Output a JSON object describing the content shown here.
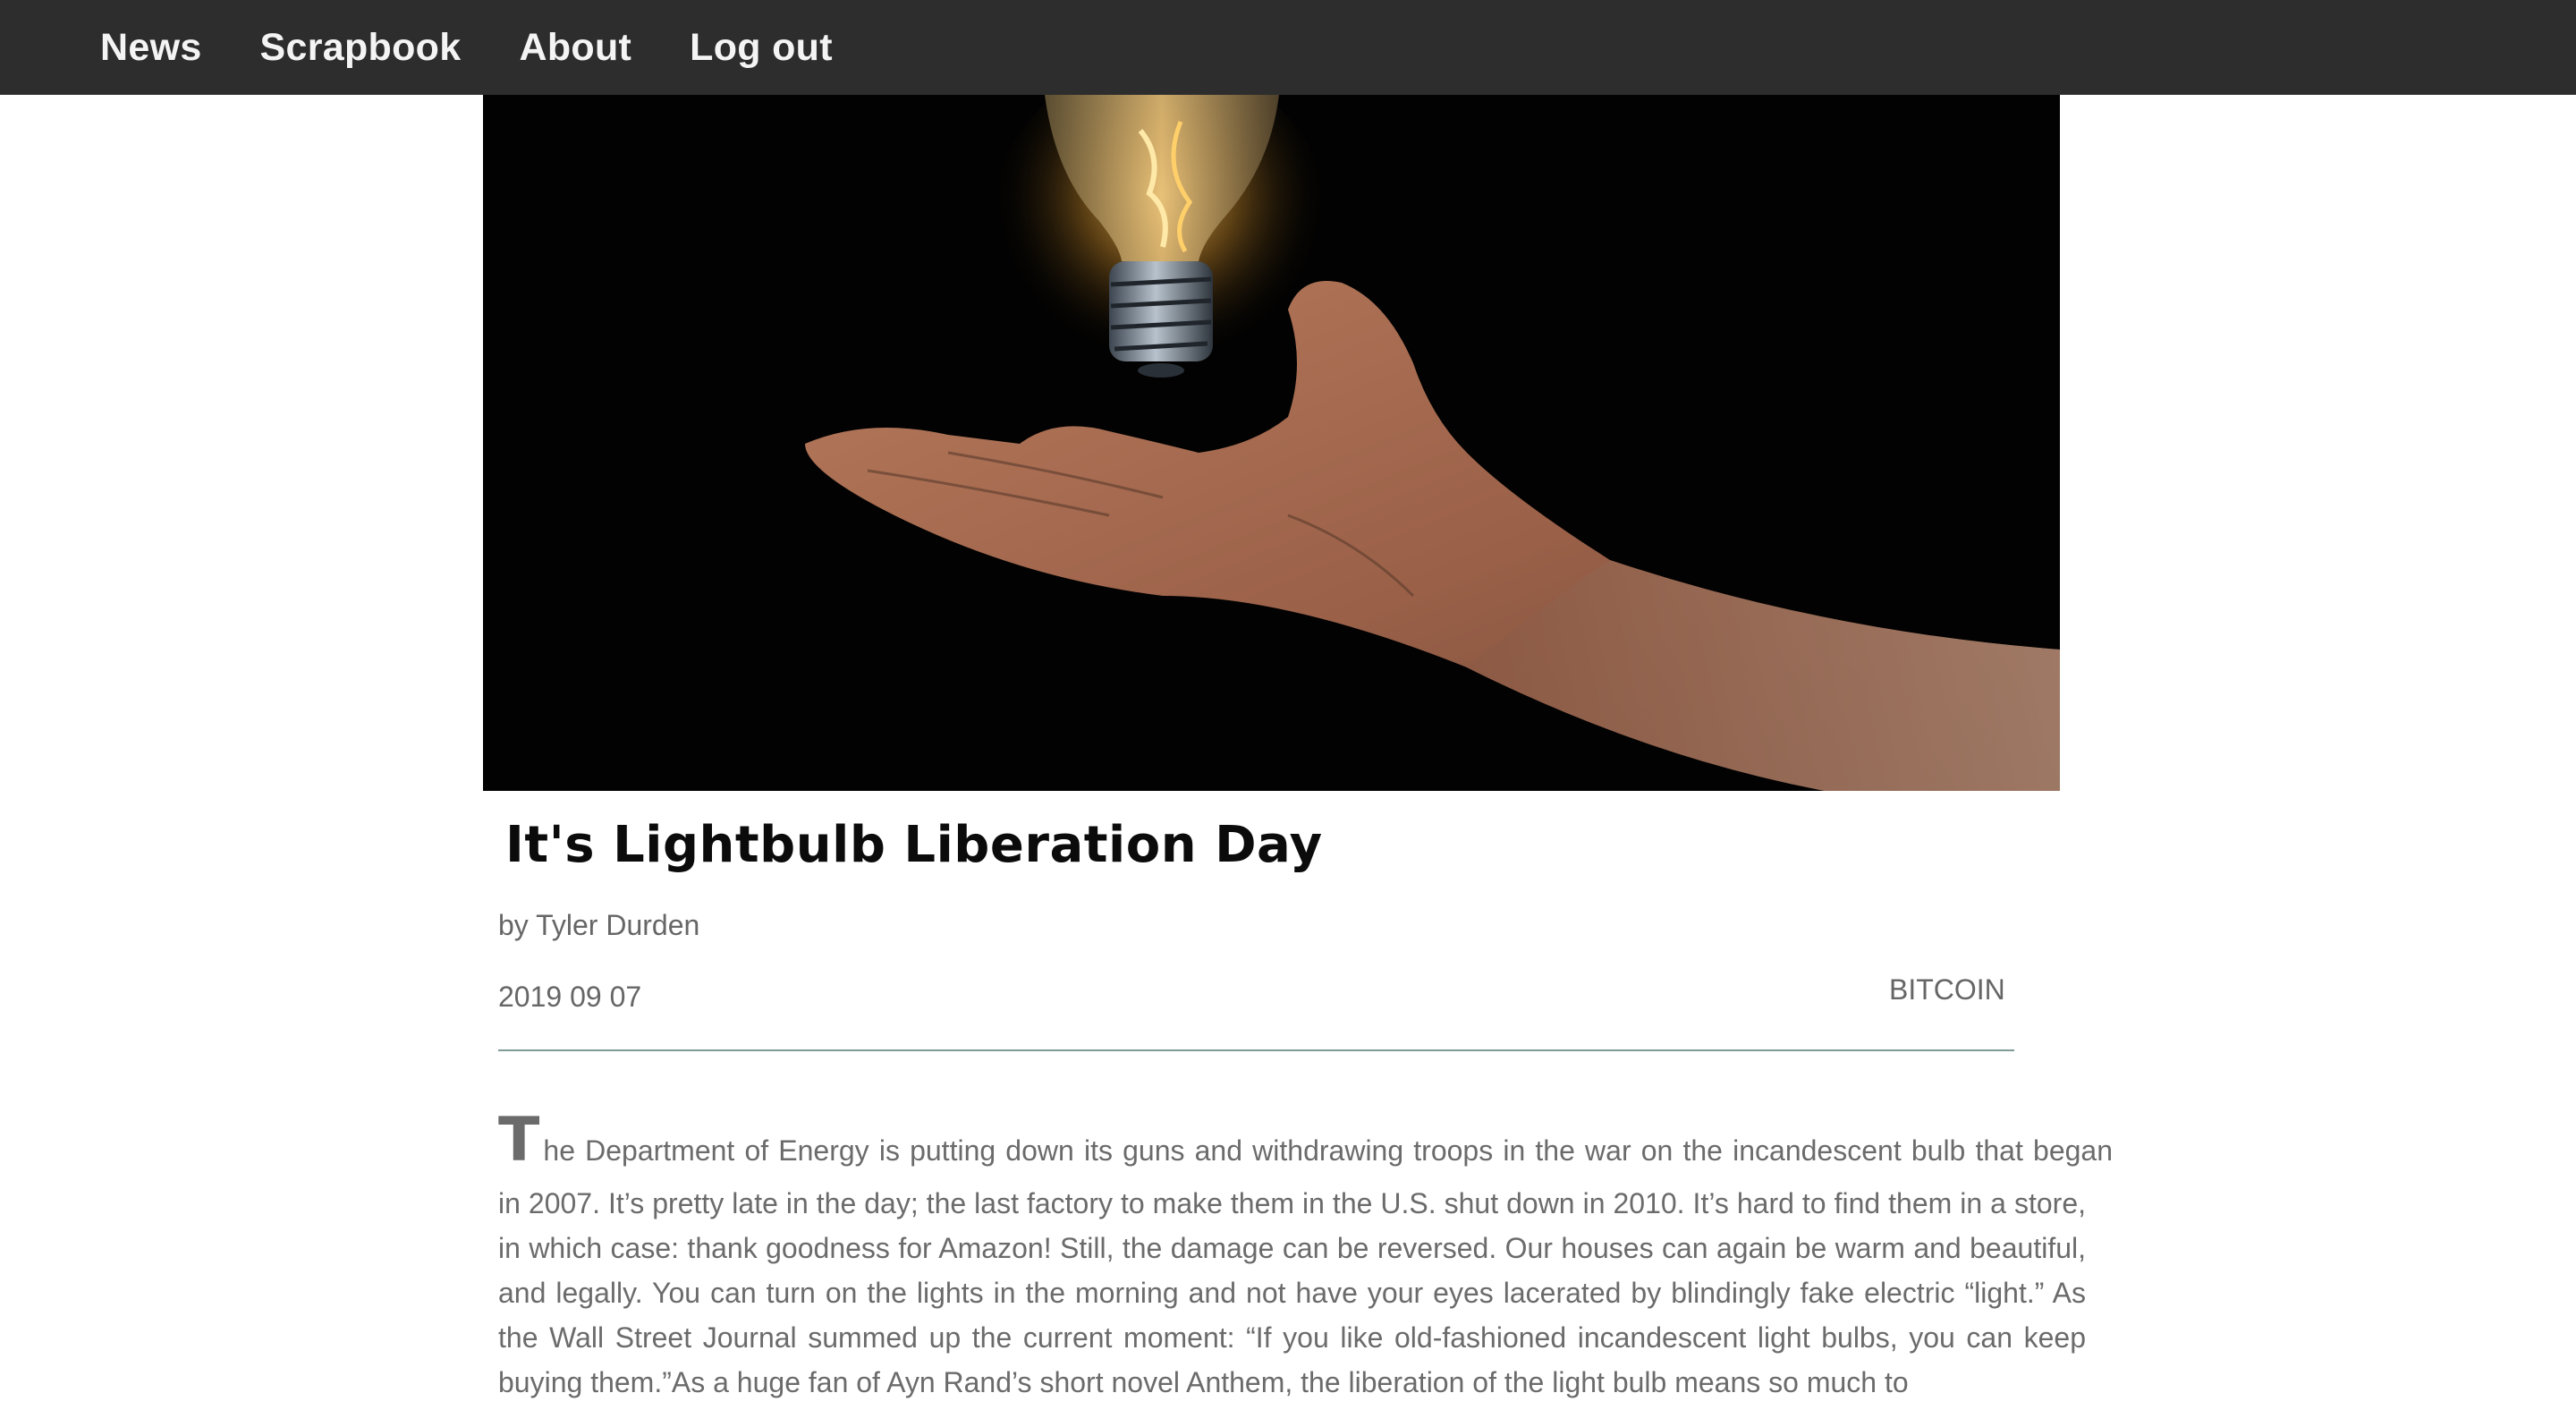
{
  "nav": {
    "items": [
      {
        "label": "News"
      },
      {
        "label": "Scrapbook"
      },
      {
        "label": "About"
      },
      {
        "label": "Log out"
      }
    ]
  },
  "hero_image": {
    "icon": "lightbulb-over-hand-photo"
  },
  "article": {
    "title": "It's Lightbulb Liberation Day",
    "byline": "by Tyler Durden",
    "date": "2019 09 07",
    "tag": "BITCOIN",
    "drop_cap": "T",
    "first_line": "he Department of Energy is putting down its guns and withdrawing troops in the war on the incandescent bulb that began",
    "body": "in 2007. It’s pretty late in the day; the last factory to make them in the U.S. shut down in 2010. It’s hard to find them in a store, in which case: thank goodness for Amazon! Still, the damage can be reversed. Our houses can again be warm and beautiful, and legally. You can turn on the lights in the morning and not have your eyes lacerated by blindingly fake electric “light.” As the Wall Street Journal summed up the current moment: “If you like old-fashioned incandescent light bulbs, you can keep buying them.”As a huge fan of Ayn Rand’s short novel Anthem, the liberation of the light bulb means so much to"
  }
}
